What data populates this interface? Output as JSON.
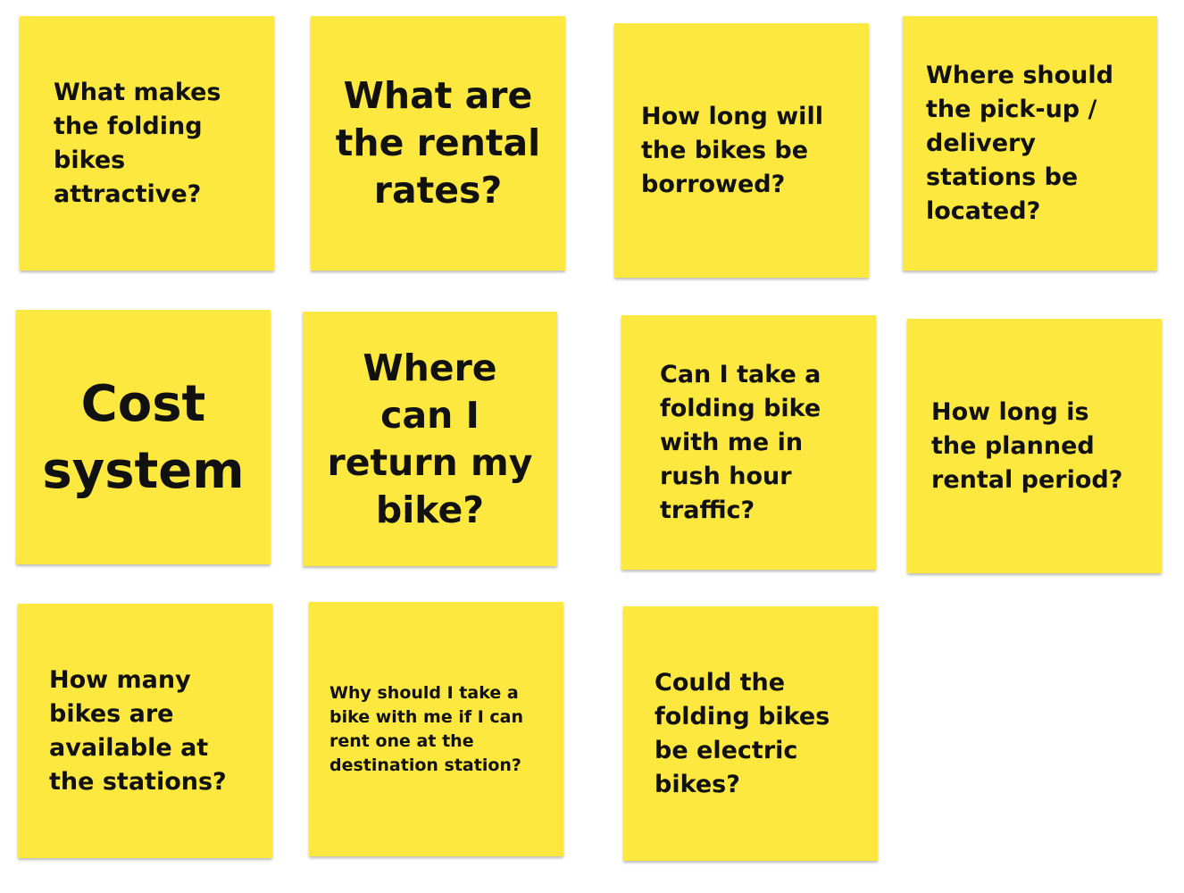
{
  "board": {
    "notes": [
      {
        "text": "What makes\nthe folding\nbikes\nattractive?"
      },
      {
        "text": "What are\nthe rental\nrates?"
      },
      {
        "text": "How long will\nthe bikes be\nborrowed?"
      },
      {
        "text": "Where should\nthe pick-up /\ndelivery\nstations be\nlocated?"
      },
      {
        "text": "Cost\nsystem"
      },
      {
        "text": "Where\ncan I\nreturn my\nbike?"
      },
      {
        "text": "Can I take a\nfolding bike\nwith me in\nrush hour\ntraffic?"
      },
      {
        "text": "How long is\nthe planned\nrental period?"
      },
      {
        "text": "How many\nbikes are\navailable at\nthe stations?"
      },
      {
        "text": "Why should I take a\nbike with me if I can\nrent one at the\ndestination station?"
      },
      {
        "text": "Could the\nfolding bikes\nbe electric\nbikes?"
      }
    ]
  },
  "colors": {
    "note_fill": "#fde83f",
    "note_text": "#111111",
    "background": "#ffffff"
  }
}
